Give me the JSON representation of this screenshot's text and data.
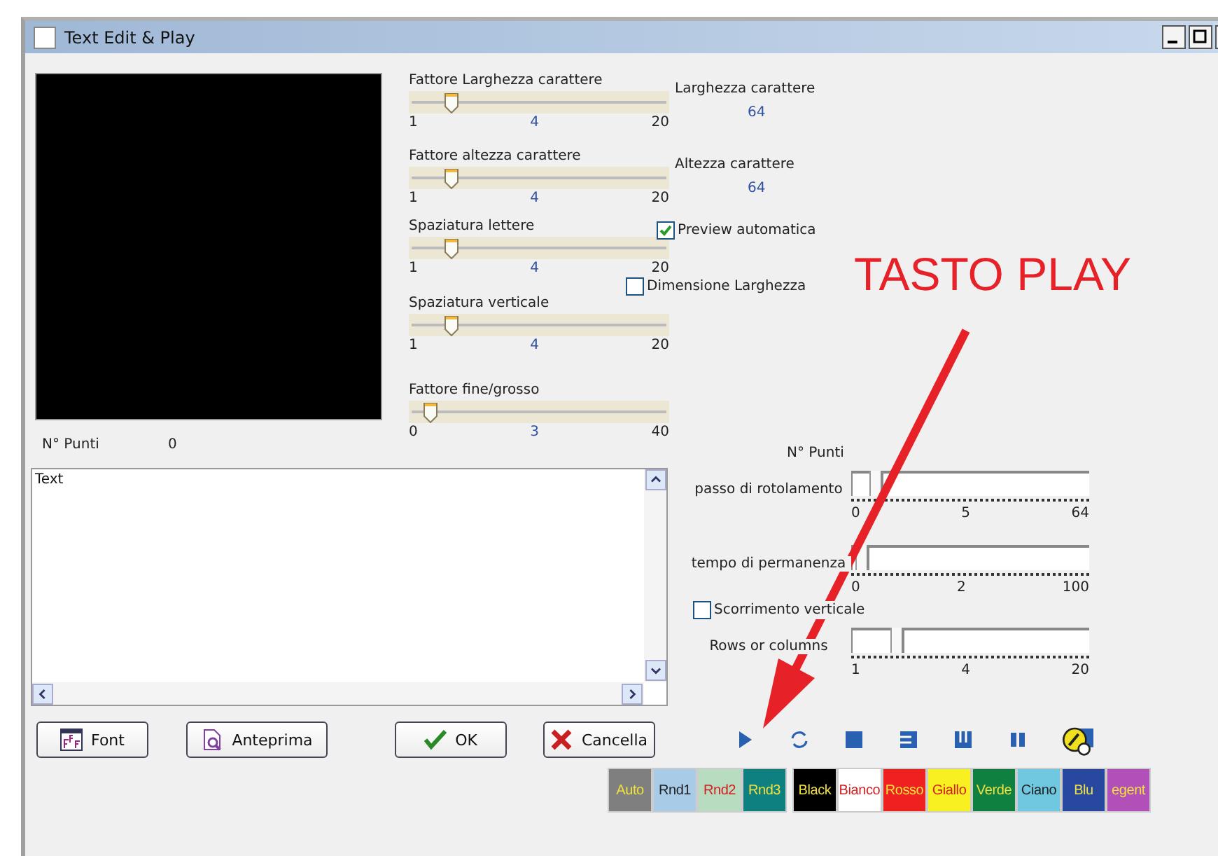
{
  "window": {
    "title": "Text Edit & Play"
  },
  "sliders": [
    {
      "label": "Fattore Larghezza carattere",
      "min": "1",
      "value": "4",
      "max": "20",
      "level": 0.16
    },
    {
      "label": "Fattore altezza carattere",
      "min": "1",
      "value": "4",
      "max": "20",
      "level": 0.16
    },
    {
      "label": "Spaziatura lettere",
      "min": "1",
      "value": "4",
      "max": "20",
      "level": 0.16
    },
    {
      "label": "Spaziatura verticale",
      "min": "1",
      "value": "4",
      "max": "20",
      "level": 0.16
    },
    {
      "label": "Fattore fine/grosso",
      "min": "0",
      "value": "3",
      "max": "40",
      "level": 0.08
    }
  ],
  "info": [
    {
      "label": "Larghezza carattere",
      "value": "64"
    },
    {
      "label": "Altezza carattere",
      "value": "64"
    }
  ],
  "options": [
    {
      "label": "Preview automatica",
      "checked": true
    },
    {
      "label": "Dimensione Larghezza",
      "checked": false
    }
  ],
  "points_left": {
    "label": "N° Punti",
    "value": "0"
  },
  "points_right": {
    "label": "N° Punti"
  },
  "text_area": {
    "value": "Text"
  },
  "scroll_controls": [
    {
      "kind": "slider",
      "label": "passo di rotolamento",
      "ticks": [
        "0",
        "5",
        "64"
      ],
      "level": 0.1
    },
    {
      "kind": "slider",
      "label": "tempo di permanenza",
      "ticks": [
        "0",
        "2",
        "100"
      ],
      "level": 0.04
    },
    {
      "kind": "checkbox",
      "label": "Scorrimento verticale",
      "checked": false
    },
    {
      "kind": "slider",
      "label": "Rows or columns",
      "ticks": [
        "1",
        "4",
        "20"
      ],
      "level": 0.19
    }
  ],
  "buttons": [
    {
      "kind": "font",
      "label": "Font"
    },
    {
      "kind": "preview",
      "label": "Anteprima"
    },
    {
      "kind": "ok",
      "label": "OK"
    },
    {
      "kind": "cancel",
      "label": "Cancella"
    }
  ],
  "color_buttons": [
    {
      "label": "Auto",
      "color": "#7f7f7f"
    },
    {
      "label": "Rnd1",
      "color": "#a8cce8"
    },
    {
      "label": "Rnd2",
      "color": "#b8dcc0"
    },
    {
      "label": "Rnd3",
      "color": "#0f8080"
    },
    {
      "label": "Black",
      "color": "#000000"
    },
    {
      "label": "Bianco",
      "color": "#ffffff"
    },
    {
      "label": "Rosso",
      "color": "#ee2020"
    },
    {
      "label": "Giallo",
      "color": "#f8f020"
    },
    {
      "label": "Verde",
      "color": "#108040"
    },
    {
      "label": "Ciano",
      "color": "#70c8e0"
    },
    {
      "label": "Blu",
      "color": "#2848a0"
    },
    {
      "label": "egent",
      "color": "#b050b8"
    }
  ],
  "annotation": {
    "text": "TASTO PLAY"
  }
}
